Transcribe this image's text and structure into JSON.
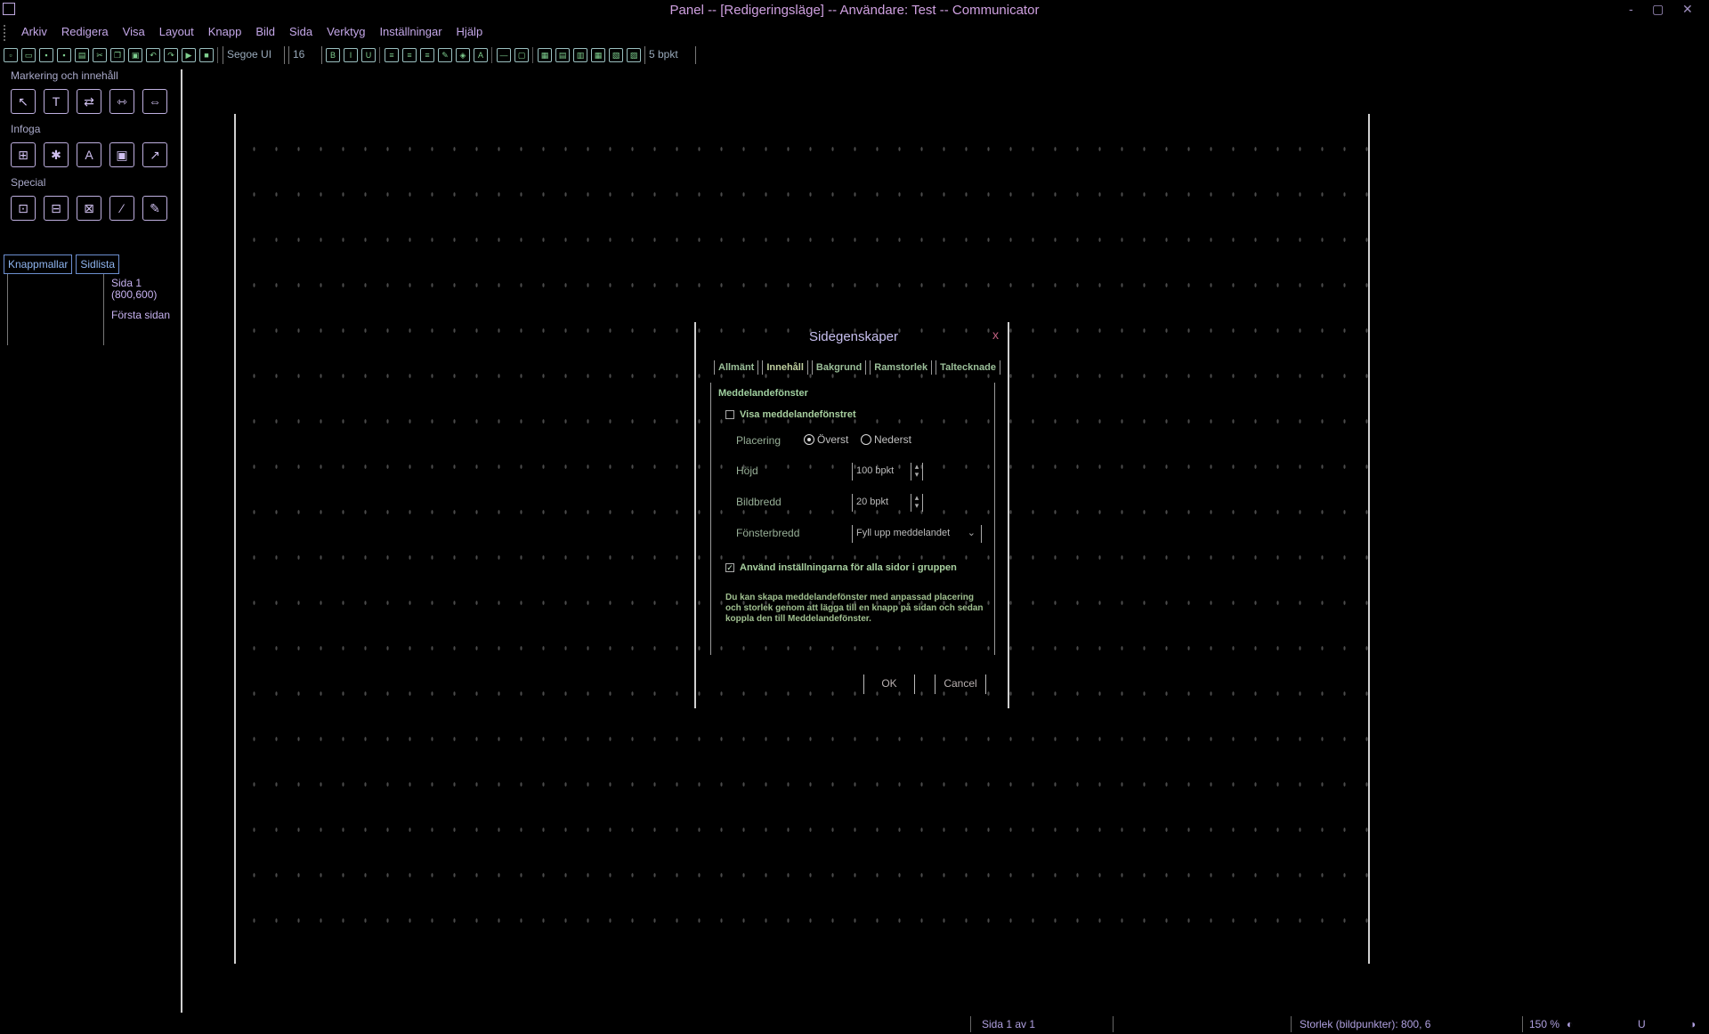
{
  "window": {
    "title": "Panel -- [Redigeringsläge] -- Användare: Test -- Communicator",
    "minimize": "-",
    "maximize": "▢",
    "close": "✕"
  },
  "menu": [
    "Arkiv",
    "Redigera",
    "Visa",
    "Layout",
    "Knapp",
    "Bild",
    "Sida",
    "Verktyg",
    "Inställningar",
    "Hjälp"
  ],
  "toolbar": {
    "font_name": "Segoe UI",
    "font_size": "16",
    "spacing": "5 bpkt"
  },
  "left_panel": {
    "section_select": "Markering och innehåll",
    "section_insert": "Infoga",
    "section_special": "Special",
    "tabs": [
      "Knappmallar",
      "Sidlista"
    ],
    "page_name": "Sida 1",
    "page_size": "(800,600)",
    "first_page": "Första sidan"
  },
  "dialog": {
    "title": "Sidegenskaper",
    "close": "x",
    "tabs": [
      "Allmänt",
      "Innehåll",
      "Bakgrund",
      "Ramstorlek",
      "Taltecknade"
    ],
    "active_tab": 1,
    "group_title": "Meddelandefönster",
    "show_box_label": "Visa meddelandefönstret",
    "placement_label": "Placering",
    "radio_top": "Överst",
    "radio_bottom": "Nederst",
    "height_label": "Höjd",
    "height_value": "100 bpkt",
    "image_width_label": "Bildbredd",
    "image_width_value": "20 bpkt",
    "window_width_label": "Fönsterbredd",
    "window_width_value": "Fyll upp meddelandet",
    "apply_all_label": "Använd inställningarna för alla sidor i gruppen",
    "description": "Du kan skapa meddelandefönster med anpassad placering och storlek genom att lägga till en knapp på sidan och sedan koppla den till Meddelandefönster.",
    "ok": "OK",
    "cancel": "Cancel"
  },
  "status": {
    "page": "Sida 1 av 1",
    "size": "Storlek (bildpunkter): 800, 6",
    "zoom": "150 %",
    "mode": "U"
  }
}
